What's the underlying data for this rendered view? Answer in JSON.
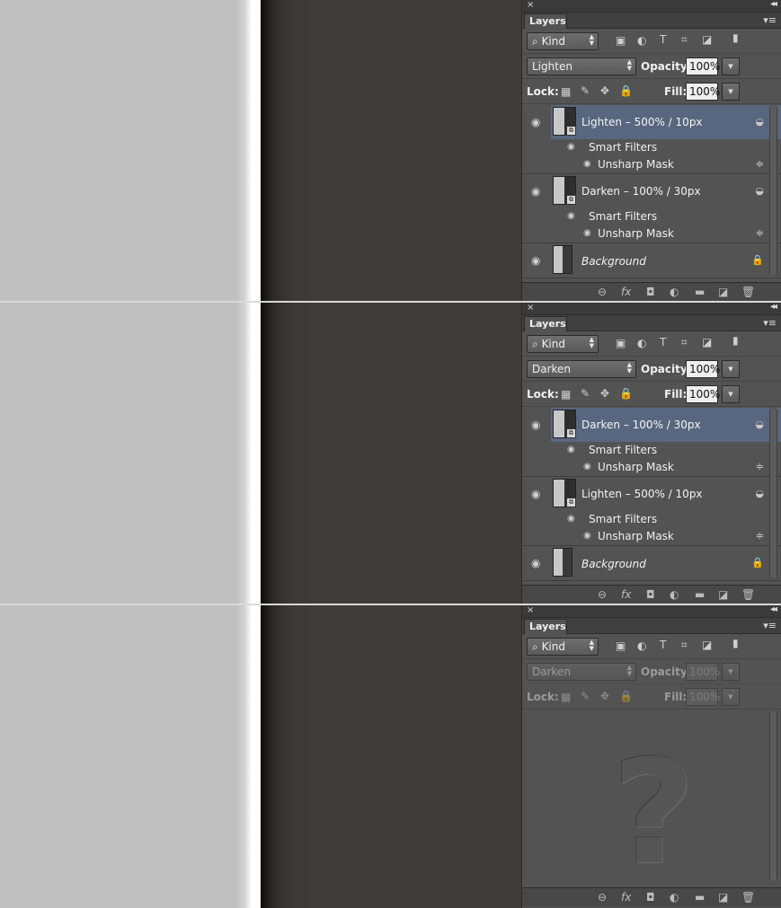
{
  "panels": [
    {
      "tab": "Layers",
      "kind": "Kind",
      "blend_mode": "Lighten",
      "opacity_label": "Opacity:",
      "opacity": "100%",
      "lock_label": "Lock:",
      "fill_label": "Fill:",
      "fill": "100%",
      "layers": [
        {
          "name": "Lighten – 500% / 10px",
          "selected": true,
          "smart_filters": "Smart Filters",
          "filter": "Unsharp Mask"
        },
        {
          "name": "Darken – 100% / 30px",
          "selected": false,
          "smart_filters": "Smart Filters",
          "filter": "Unsharp Mask"
        }
      ],
      "background": "Background"
    },
    {
      "tab": "Layers",
      "kind": "Kind",
      "blend_mode": "Darken",
      "opacity_label": "Opacity:",
      "opacity": "100%",
      "lock_label": "Lock:",
      "fill_label": "Fill:",
      "fill": "100%",
      "layers": [
        {
          "name": "Darken – 100% / 30px",
          "selected": true,
          "smart_filters": "Smart Filters",
          "filter": "Unsharp Mask"
        },
        {
          "name": "Lighten – 500% / 10px",
          "selected": false,
          "smart_filters": "Smart Filters",
          "filter": "Unsharp Mask"
        }
      ],
      "background": "Background"
    },
    {
      "tab": "Layers",
      "kind": "Kind",
      "blend_mode": "Darken",
      "opacity_label": "Opacity:",
      "opacity": "100%",
      "lock_label": "Lock:",
      "fill_label": "Fill:",
      "fill": "100%",
      "placeholder": "?"
    }
  ],
  "icons": {
    "close": "×",
    "collapse": "◂◂",
    "panel_menu": "▾≡",
    "search": "⌕",
    "eye": "👁",
    "link": "⊖",
    "fx": "fx",
    "mask": "◘",
    "adjust": "◐",
    "folder": "▬",
    "new": "◪",
    "trash": "🗑",
    "lock": "🔒",
    "filter_options": "≑"
  }
}
